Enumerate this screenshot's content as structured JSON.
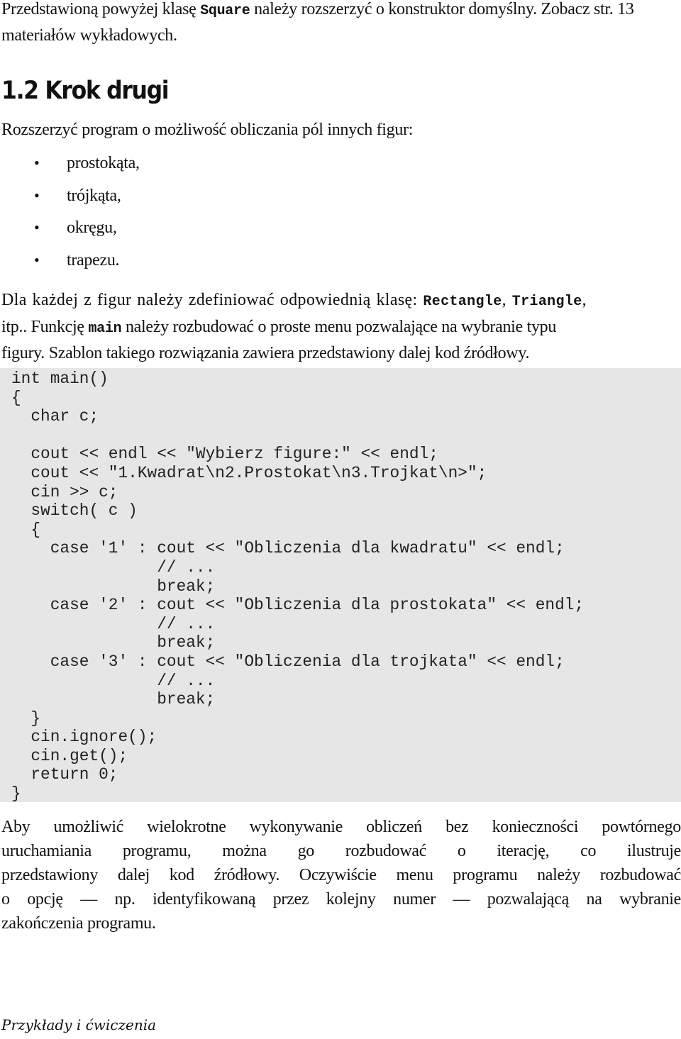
{
  "intro": {
    "text_before": "Przedstawioną powyżej klasę ",
    "code_class": "Square",
    "text_after": " należy rozszerzyć o konstruktor domyślny. Zobacz str. 13 materiałów wykładowych."
  },
  "section": {
    "number": "1.2",
    "title": "1.2 Krok drugi"
  },
  "task": {
    "lead": "Rozszerzyć program o możliwość obliczania pól innych figur:",
    "bullet_glyph": "•",
    "items": [
      "prostokąta,",
      "trójkąta,",
      "okręgu,",
      "trapezu."
    ]
  },
  "classes_paragraph": {
    "line1_before": "Dla każdej z figur należy zdefiniować odpowiednią klasę: ",
    "code_rectangle": "Rectangle",
    "sep": ", ",
    "code_triangle": "Triangle",
    "line1_end": ",",
    "line2_before": "itp.. Funkcję ",
    "code_main": "main",
    "line2_after": " należy rozbudować o proste menu pozwalające na wybranie typu",
    "line3": "figury. Szablon takiego rozwiązania zawiera przedstawiony dalej kod źródłowy."
  },
  "code_listing": {
    "language": "C++",
    "lines": [
      "int main()",
      "{",
      "  char c;",
      "",
      "  cout << endl << \"Wybierz figure:\" << endl;",
      "  cout << \"1.Kwadrat\\n2.Prostokat\\n3.Trojkat\\n>\";",
      "  cin >> c;",
      "  switch( c )",
      "  {",
      "    case '1' : cout << \"Obliczenia dla kwadratu\" << endl;",
      "               // ...",
      "               break;",
      "    case '2' : cout << \"Obliczenia dla prostokata\" << endl;",
      "               // ...",
      "               break;",
      "    case '3' : cout << \"Obliczenia dla trojkata\" << endl;",
      "               // ...",
      "               break;",
      "  }",
      "  cin.ignore();",
      "  cin.get();",
      "  return 0;",
      "}"
    ],
    "background": "#e6e6e6"
  },
  "iteration_paragraph": {
    "lines": [
      "Aby umożliwić wielokrotne wykonywanie obliczeń bez konieczności powtórnego",
      "uruchamiania programu, można go rozbudować o iterację, co ilustruje",
      "przedstawiony dalej kod źródłowy. Oczywiście menu programu należy rozbudować",
      "o opcję — np. identyfikowaną przez kolejny numer — pozwalającą na wybranie",
      "zakończenia programu."
    ]
  },
  "footer": {
    "text": "Przykłady i ćwiczenia"
  }
}
